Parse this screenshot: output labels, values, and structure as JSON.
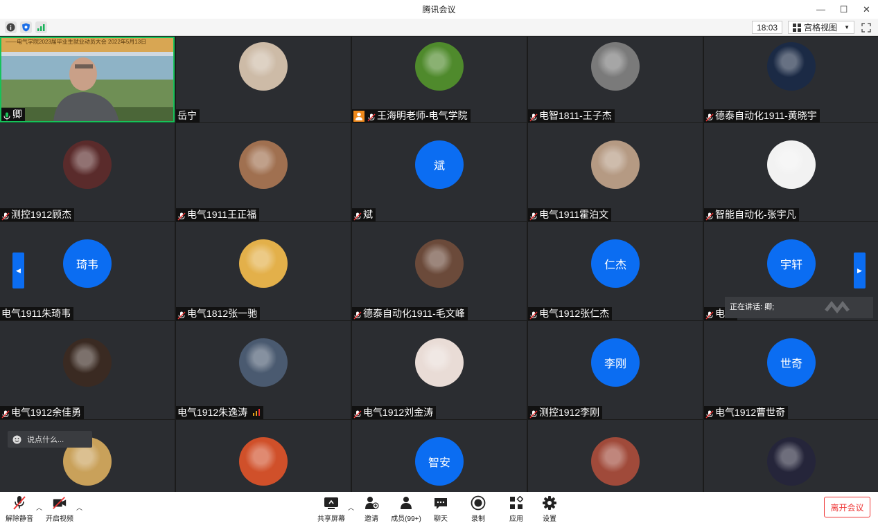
{
  "window": {
    "title": "腾讯会议",
    "controls": [
      "—",
      "☐",
      "✕"
    ]
  },
  "toolbar": {
    "time": "18:03",
    "view_label": "宫格视图"
  },
  "banner": {
    "line1": "——电气学院2023届毕业生就业动员大会 2022年5月13日"
  },
  "participants": [
    {
      "name": "卿",
      "kind": "video"
    },
    {
      "name": "岳宁",
      "kind": "photo",
      "color": "#cdbba7"
    },
    {
      "name": "王海明老师-电气学院",
      "kind": "photo",
      "color": "#4f8a2c",
      "host": true
    },
    {
      "name": "电智1811-王子杰",
      "kind": "photo",
      "color": "#7a7a7a"
    },
    {
      "name": "德泰自动化1911-黄晓宇",
      "kind": "photo",
      "color": "#1b2a45"
    },
    {
      "name": "测控1912顾杰",
      "kind": "photo",
      "color": "#5a2b2b"
    },
    {
      "name": "电气1911王正福",
      "kind": "photo",
      "color": "#a07050"
    },
    {
      "name": "斌",
      "kind": "text",
      "initials": "斌"
    },
    {
      "name": "电气1911霍泊文",
      "kind": "photo",
      "color": "#b59a83"
    },
    {
      "name": "智能自动化-张宇凡",
      "kind": "photo",
      "color": "#f2f2f2"
    },
    {
      "name": "电气1911朱琦韦",
      "kind": "text",
      "initials": "琦韦"
    },
    {
      "name": "电气1812张一驰",
      "kind": "photo",
      "color": "#e3b04a"
    },
    {
      "name": "德泰自动化1911-毛文峰",
      "kind": "photo",
      "color": "#6b4a3a"
    },
    {
      "name": "电气1912张仁杰",
      "kind": "text",
      "initials": "仁杰"
    },
    {
      "name": "电气",
      "kind": "text",
      "initials": "宇轩"
    },
    {
      "name": "电气1912余佳勇",
      "kind": "photo",
      "color": "#3a2a22"
    },
    {
      "name": "电气1912朱逸涛",
      "kind": "photo",
      "color": "#4a5a70"
    },
    {
      "name": "电气1912刘金涛",
      "kind": "photo",
      "color": "#e9dcd6"
    },
    {
      "name": "测控1912李刚",
      "kind": "text",
      "initials": "李刚"
    },
    {
      "name": "电气1912曹世奇",
      "kind": "text",
      "initials": "世奇"
    },
    {
      "name": "",
      "kind": "photo",
      "color": "#c9a15a"
    },
    {
      "name": "",
      "kind": "photo",
      "color": "#d0502a"
    },
    {
      "name": "",
      "kind": "text",
      "initials": "智安"
    },
    {
      "name": "",
      "kind": "photo",
      "color": "#a04a3a"
    },
    {
      "name": "",
      "kind": "photo",
      "color": "#25253a"
    }
  ],
  "overlays": {
    "talking_label": "正在讲话: 卿;",
    "chat_placeholder": "说点什么..."
  },
  "bottombar": {
    "unmute": "解除静音",
    "video": "开启视频",
    "share": "共享屏幕",
    "invite": "邀请",
    "members": "成员(99+)",
    "chat": "聊天",
    "record": "录制",
    "apps": "应用",
    "settings": "设置",
    "leave": "离开会议"
  },
  "colors": {
    "accent": "#0b6df2",
    "leave": "#ee3333",
    "active_speaker": "#16c25a"
  }
}
